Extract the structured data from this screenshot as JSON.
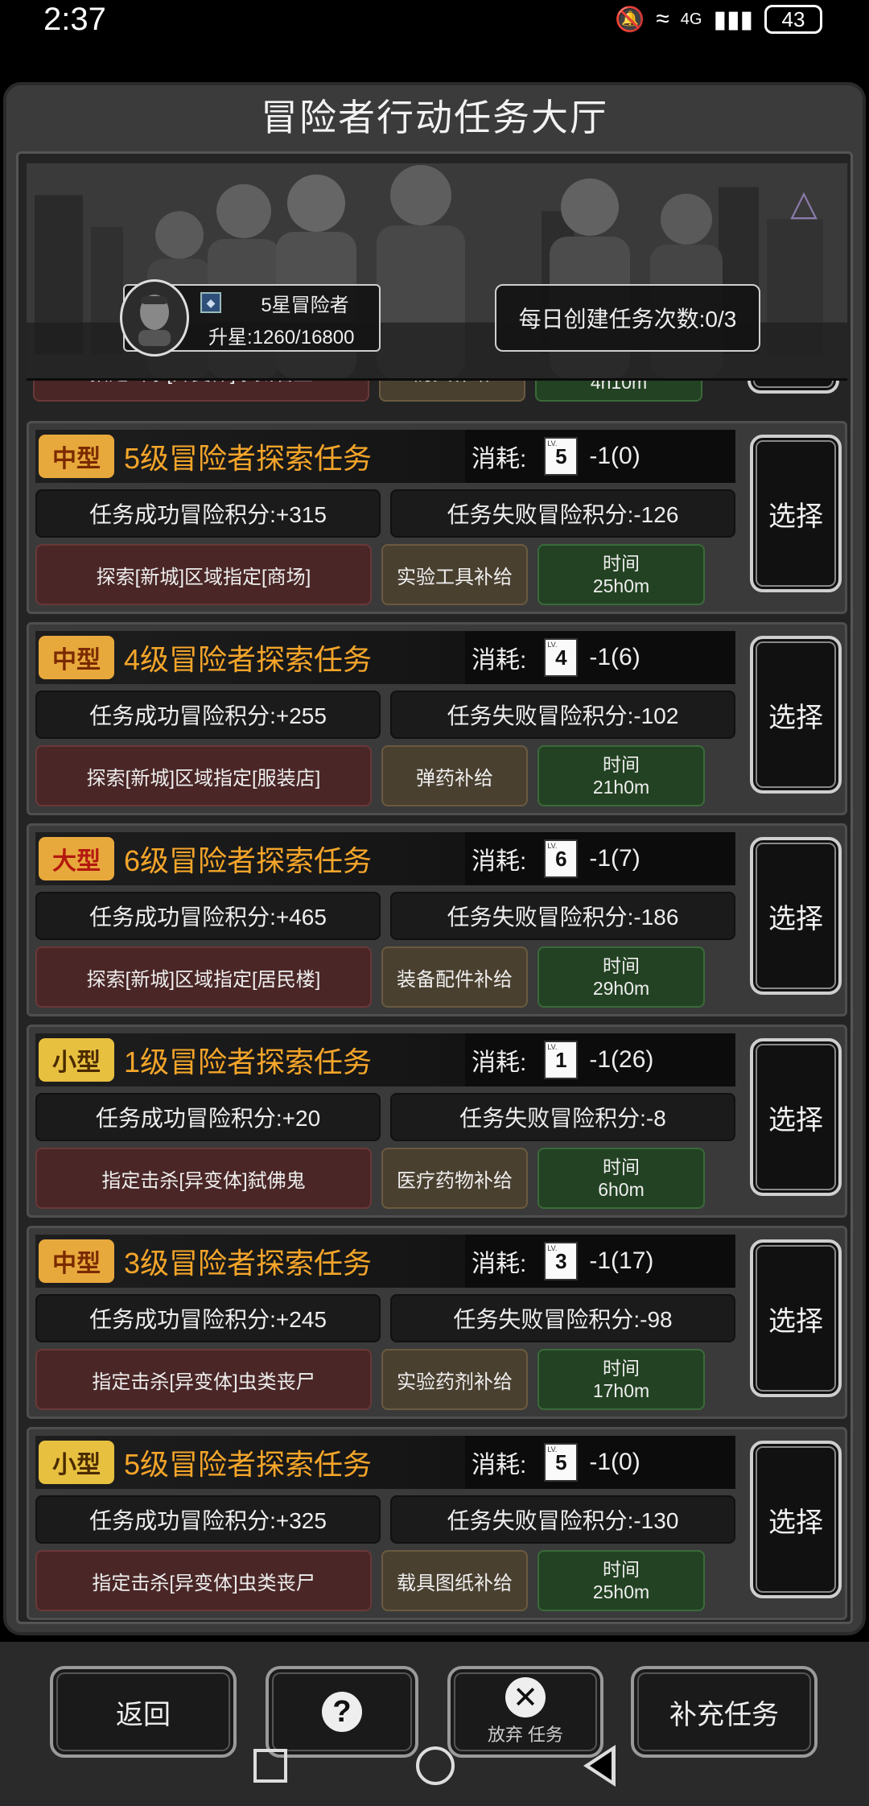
{
  "status_bar": {
    "time": "2:37",
    "battery": "43",
    "network": "4G",
    "icons": [
      "mute-bell-icon",
      "wifi-icon",
      "signal-icon",
      "battery-icon"
    ]
  },
  "title": "冒险者行动任务大厅",
  "profile": {
    "rank_name": "5星冒险者",
    "promotion": "升星:1260/16800"
  },
  "daily_create": "每日创建任务次数:0/3",
  "partial_card": {
    "target": "指定击杀[异变体]杀戮君王",
    "supply": "防具补给",
    "time": "4h10m",
    "time_label": "时间"
  },
  "cost_label": "消耗:",
  "time_label": "时间",
  "select_label": "选择",
  "missions": [
    {
      "size": "中型",
      "size_style": "mid",
      "title": "5级冒险者探索任务",
      "card_level": "5",
      "cost": "-1(0)",
      "success": "任务成功冒险积分:+315",
      "fail": "任务失败冒险积分:-126",
      "target": "探索[新城]区域指定[商场]",
      "supply": "实验工具补给",
      "time": "25h0m"
    },
    {
      "size": "中型",
      "size_style": "mid",
      "title": "4级冒险者探索任务",
      "card_level": "4",
      "cost": "-1(6)",
      "success": "任务成功冒险积分:+255",
      "fail": "任务失败冒险积分:-102",
      "target": "探索[新城]区域指定[服装店]",
      "supply": "弹药补给",
      "time": "21h0m"
    },
    {
      "size": "大型",
      "size_style": "large",
      "title": "6级冒险者探索任务",
      "card_level": "6",
      "cost": "-1(7)",
      "success": "任务成功冒险积分:+465",
      "fail": "任务失败冒险积分:-186",
      "target": "探索[新城]区域指定[居民楼]",
      "supply": "装备配件补给",
      "time": "29h0m"
    },
    {
      "size": "小型",
      "size_style": "small",
      "title": "1级冒险者探索任务",
      "card_level": "1",
      "cost": "-1(26)",
      "success": "任务成功冒险积分:+20",
      "fail": "任务失败冒险积分:-8",
      "target": "指定击杀[异变体]弑佛鬼",
      "supply": "医疗药物补给",
      "time": "6h0m"
    },
    {
      "size": "中型",
      "size_style": "mid",
      "title": "3级冒险者探索任务",
      "card_level": "3",
      "cost": "-1(17)",
      "success": "任务成功冒险积分:+245",
      "fail": "任务失败冒险积分:-98",
      "target": "指定击杀[异变体]虫类丧尸",
      "supply": "实验药剂补给",
      "time": "17h0m"
    },
    {
      "size": "小型",
      "size_style": "small",
      "title": "5级冒险者探索任务",
      "card_level": "5",
      "cost": "-1(0)",
      "success": "任务成功冒险积分:+325",
      "fail": "任务失败冒险积分:-130",
      "target": "指定击杀[异变体]虫类丧尸",
      "supply": "载具图纸补给",
      "time": "25h0m"
    }
  ],
  "bottom": {
    "back": "返回",
    "help_icon": "question-icon",
    "abandon": "放弃 任务",
    "replenish": "补充任务"
  },
  "colors": {
    "mission_title": "#f4a52a",
    "target_bg": "#4a2626",
    "supply_bg": "#4a4030",
    "time_bg": "#234223"
  }
}
